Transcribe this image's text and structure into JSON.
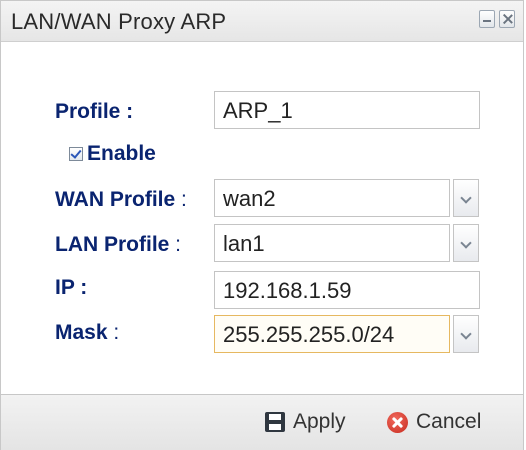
{
  "window": {
    "title": "LAN/WAN Proxy ARP"
  },
  "form": {
    "profile": {
      "label": "Profile :",
      "value": "ARP_1"
    },
    "enable": {
      "label": "Enable",
      "checked": true
    },
    "wan_profile": {
      "label": "WAN Profile",
      "suffix": " :",
      "value": "wan2"
    },
    "lan_profile": {
      "label": "LAN Profile",
      "suffix": " :",
      "value": "lan1"
    },
    "ip": {
      "label": "IP :",
      "value": "192.168.1.59"
    },
    "mask": {
      "label": "Mask",
      "suffix": " :",
      "value": "255.255.255.0/24"
    }
  },
  "footer": {
    "apply_label": "Apply",
    "cancel_label": "Cancel"
  }
}
